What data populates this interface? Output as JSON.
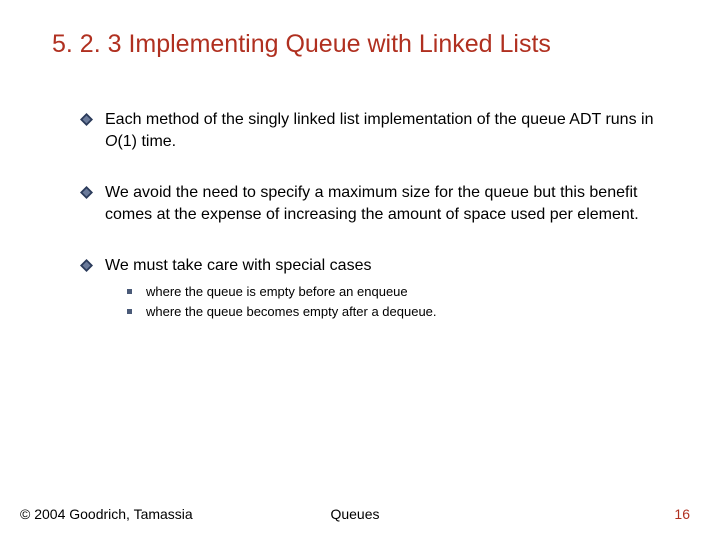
{
  "title": "5. 2. 3 Implementing Queue with Linked Lists",
  "bullets": {
    "b1_pre": "Each method of the singly linked list implementation of the queue ADT runs in ",
    "b1_bigO": "O",
    "b1_post": "(1) time.",
    "b2": " We avoid the need to specify a maximum size for the queue but this benefit comes at the expense of increasing the amount of space used per element.",
    "b3": "We must take care with special cases",
    "sub1": "where the queue is empty before an enqueue",
    "sub2": "where the queue becomes empty after a dequeue."
  },
  "footer": {
    "copyright": "© 2004 Goodrich, Tamassia",
    "center": "Queues",
    "page": "16"
  }
}
